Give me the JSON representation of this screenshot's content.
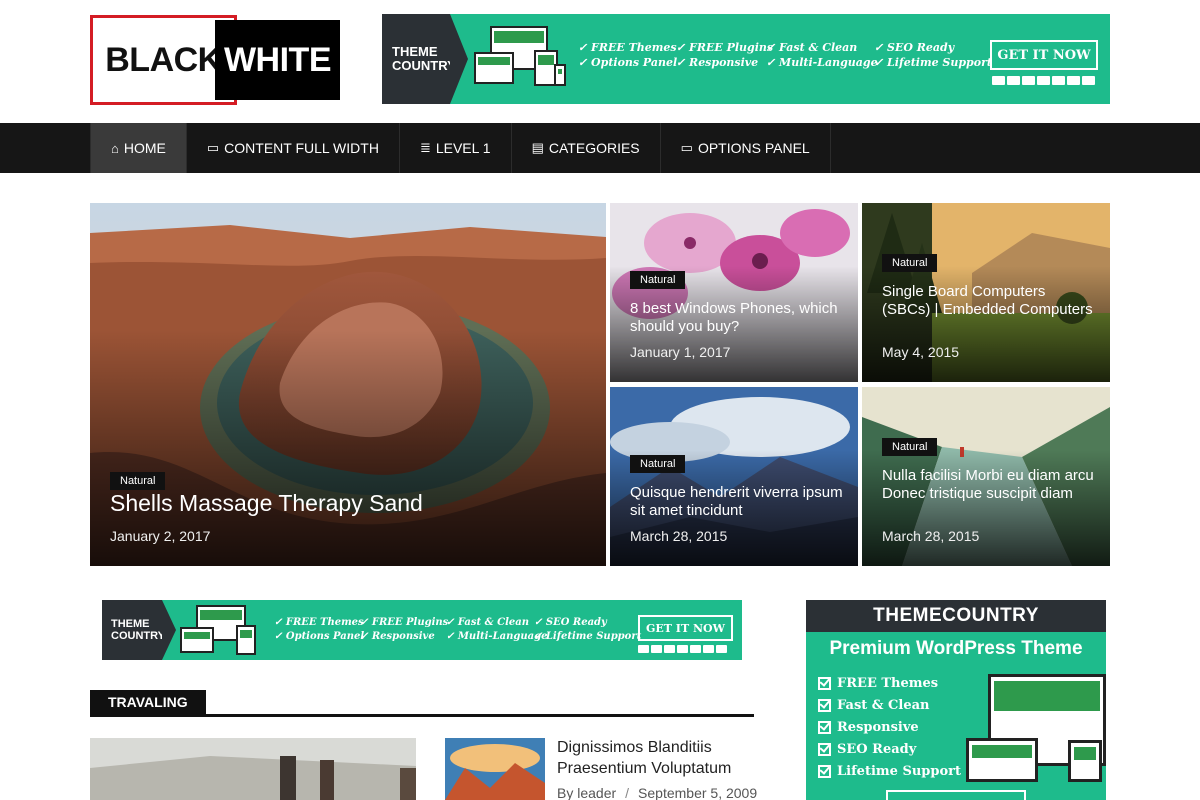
{
  "logo": {
    "part1": "BLACK",
    "part2": "WHITE"
  },
  "header_ad": {
    "brand_line1": "THEME",
    "brand_line2": "COUNTRY",
    "features": [
      [
        "✓ FREE Themes",
        "✓ Options Panel"
      ],
      [
        "✓ FREE Plugins",
        "✓ Responsive"
      ],
      [
        "✓ Fast & Clean",
        "✓ Multi-Language"
      ],
      [
        "✓ SEO Ready",
        "✓ Lifetime Support"
      ]
    ],
    "cta": "GET IT NOW"
  },
  "nav": {
    "items": [
      {
        "label": "HOME",
        "icon": "home-icon",
        "glyph": "⌂",
        "active": true
      },
      {
        "label": "CONTENT FULL WIDTH",
        "icon": "credit-card-icon",
        "glyph": "▭"
      },
      {
        "label": "LEVEL 1",
        "icon": "list-icon",
        "glyph": "≣"
      },
      {
        "label": "CATEGORIES",
        "icon": "archive-icon",
        "glyph": "▤"
      },
      {
        "label": "OPTIONS PANEL",
        "icon": "desktop-icon",
        "glyph": "▭"
      }
    ]
  },
  "featured": [
    {
      "category": "Natural",
      "title": "Shells Massage Therapy Sand",
      "date": "January 2, 2017"
    },
    {
      "category": "Natural",
      "title": "8 best Windows Phones, which should you buy?",
      "date": "January 1, 2017"
    },
    {
      "category": "Natural",
      "title": "Single Board Computers (SBCs) | Embedded Computers",
      "date": "May 4, 2015"
    },
    {
      "category": "Natural",
      "title": "Quisque hendrerit viverra ipsum sit amet tincidunt",
      "date": "March 28, 2015"
    },
    {
      "category": "Natural",
      "title": "Nulla facilisi Morbi eu diam arcu Donec tristique suscipit diam",
      "date": "March 28, 2015"
    }
  ],
  "content_ad": {
    "brand_line1": "THEME",
    "brand_line2": "COUNTRY",
    "features": [
      [
        "✓ FREE Themes",
        "✓ Options Panel"
      ],
      [
        "✓ FREE Plugins",
        "✓ Responsive"
      ],
      [
        "✓ Fast & Clean",
        "✓ Multi-Language"
      ],
      [
        "✓ SEO Ready",
        "✓ Lifetime Support"
      ]
    ],
    "cta": "GET IT NOW"
  },
  "section": {
    "title": "TRAVALING"
  },
  "post": {
    "title": "Dignissimos Blanditiis Praesentium Voluptatum",
    "author": "By leader",
    "separator": "/",
    "date": "September 5, 2009"
  },
  "sidebar_ad": {
    "brand": "THEMECOUNTRY",
    "subtitle": "Premium WordPress Theme",
    "features": [
      "FREE Themes",
      "Fast & Clean",
      "Responsive",
      "SEO Ready",
      "Lifetime Support"
    ]
  },
  "colors": {
    "accent_green": "#1ebb8c",
    "dark_bar": "#161616",
    "logo_red": "#d41c24"
  }
}
